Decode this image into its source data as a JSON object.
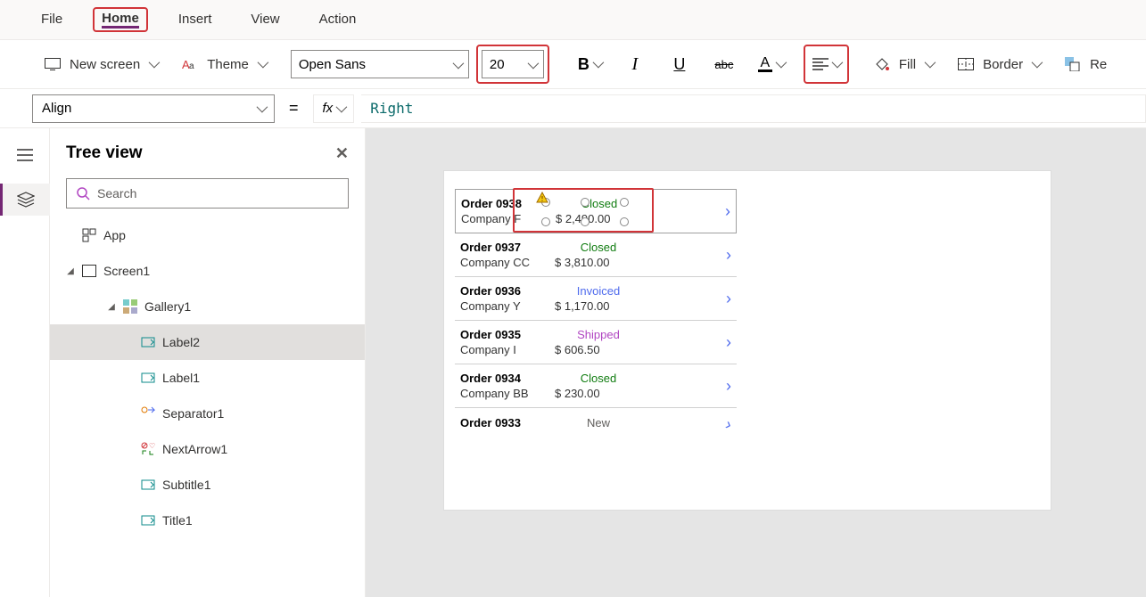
{
  "menu": {
    "file": "File",
    "home": "Home",
    "insert": "Insert",
    "view": "View",
    "action": "Action"
  },
  "ribbon": {
    "new_screen": "New screen",
    "theme": "Theme",
    "font_name": "Open Sans",
    "font_size": "20",
    "fill": "Fill",
    "border": "Border",
    "reorder": "Re"
  },
  "formula": {
    "property": "Align",
    "fx": "fx",
    "expr": "Right"
  },
  "panel": {
    "title": "Tree view",
    "search_placeholder": "Search"
  },
  "tree": {
    "app": "App",
    "screen": "Screen1",
    "gallery": "Gallery1",
    "items": [
      "Label2",
      "Label1",
      "Separator1",
      "NextArrow1",
      "Subtitle1",
      "Title1"
    ]
  },
  "orders": [
    {
      "id": "Order 0938",
      "company": "Company F",
      "status": "Closed",
      "status_cls": "closed",
      "price": "$ 2,490.00"
    },
    {
      "id": "Order 0937",
      "company": "Company CC",
      "status": "Closed",
      "status_cls": "closed",
      "price": "$ 3,810.00"
    },
    {
      "id": "Order 0936",
      "company": "Company Y",
      "status": "Invoiced",
      "status_cls": "invoiced",
      "price": "$ 1,170.00"
    },
    {
      "id": "Order 0935",
      "company": "Company I",
      "status": "Shipped",
      "status_cls": "shipped",
      "price": "$ 606.50"
    },
    {
      "id": "Order 0934",
      "company": "Company BB",
      "status": "Closed",
      "status_cls": "closed",
      "price": "$ 230.00"
    },
    {
      "id": "Order 0933",
      "company": "",
      "status": "New",
      "status_cls": "new",
      "price": ""
    }
  ]
}
